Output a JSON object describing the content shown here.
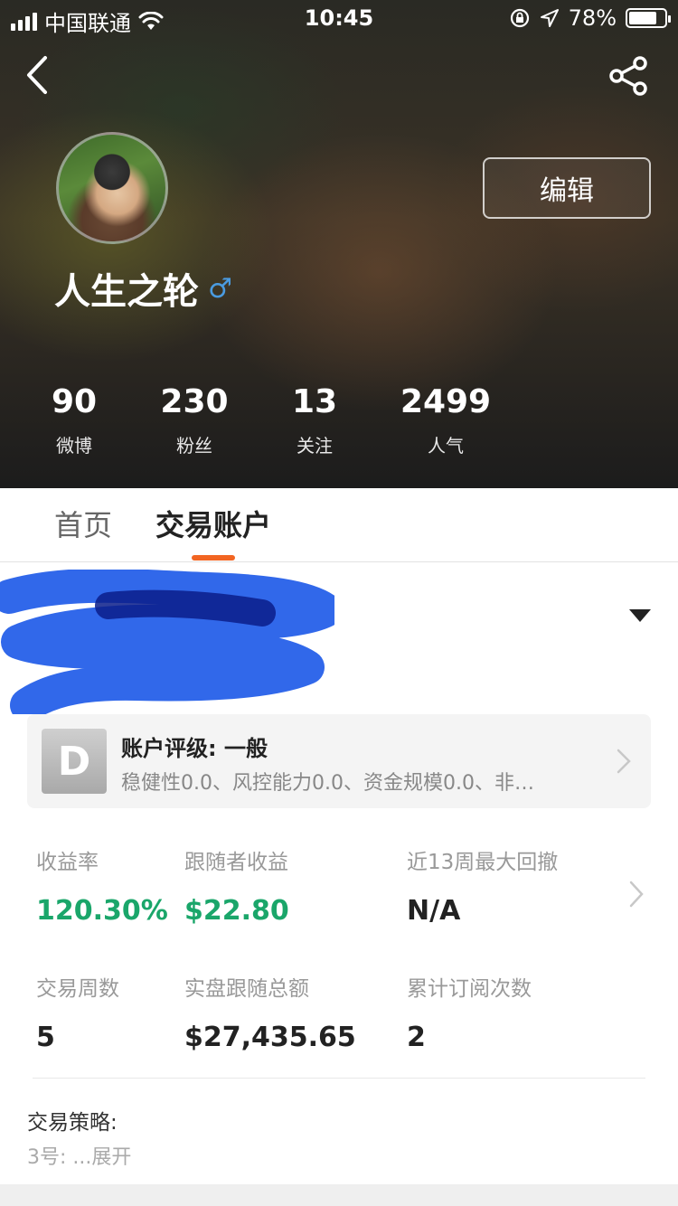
{
  "status_bar": {
    "carrier": "中国联通",
    "time": "10:45",
    "battery_percent": "78%",
    "battery_level": 0.78
  },
  "header": {
    "edit_label": "编辑",
    "username": "人生之轮",
    "gender_symbol": "♂",
    "stats": [
      {
        "value": "90",
        "label": "微博"
      },
      {
        "value": "230",
        "label": "粉丝"
      },
      {
        "value": "13",
        "label": "关注"
      },
      {
        "value": "2499",
        "label": "人气"
      }
    ]
  },
  "tabs": [
    {
      "label": "首页",
      "active": false
    },
    {
      "label": "交易账户",
      "active": true
    }
  ],
  "tab_accent_color": "#f26522",
  "rating": {
    "grade": "D",
    "title": "账户评级: 一般",
    "description": "稳健性0.0、风控能力0.0、资金规模0.0、非…"
  },
  "metrics": [
    {
      "label": "收益率",
      "value": "120.30%",
      "highlight": true
    },
    {
      "label": "跟随者收益",
      "value": "$22.80",
      "highlight": true
    },
    {
      "label": "近13周最大回撤",
      "value": "N/A",
      "highlight": false
    },
    {
      "label": "交易周数",
      "value": "5",
      "highlight": false
    },
    {
      "label": "实盘跟随总额",
      "value": "$27,435.65",
      "highlight": false
    },
    {
      "label": "累计订阅次数",
      "value": "2",
      "highlight": false
    }
  ],
  "positive_color": "#1aa66a",
  "strategy": {
    "label": "交易策略:",
    "text": "3号:",
    "expand": "...展开"
  }
}
